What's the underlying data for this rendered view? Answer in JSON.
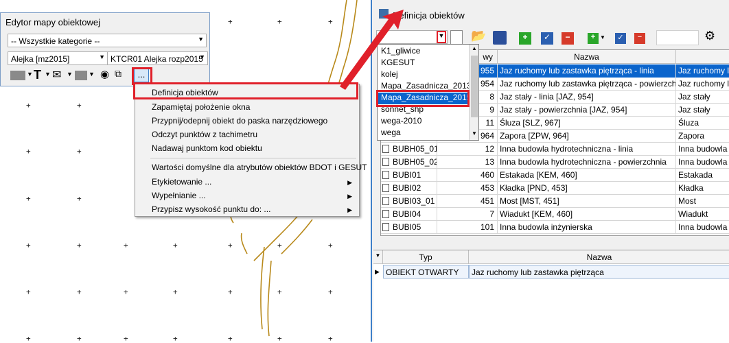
{
  "editor": {
    "title": "Edytor mapy obiektowej",
    "category_combo": "-- Wszystkie kategorie --",
    "layer_combo": "Alejka [mz2015]",
    "object_combo": "KTCR01 Alejka rozp2015",
    "more_button": "..."
  },
  "context_menu": {
    "items": [
      {
        "label": "Definicja obiektów"
      },
      {
        "label": "Zapamiętaj położenie okna"
      },
      {
        "label": "Przypnij/odepnij obiekt do paska narzędziowego"
      },
      {
        "label": "Odczyt punktów z tachimetru"
      },
      {
        "label": "Nadawaj punktom kod obiektu"
      },
      {
        "label": "Wartości domyślne dla atrybutów obiektów BDOT i GESUT"
      },
      {
        "label": "Etykietowanie ..."
      },
      {
        "label": "Wypełnianie ..."
      },
      {
        "label": "Przypisz wysokość punktu do: ..."
      }
    ]
  },
  "definitions_window": {
    "title": "Definicja obiektów",
    "columns": [
      "wy",
      "Nazwa",
      ""
    ],
    "rows": [
      {
        "code": "",
        "num": "955",
        "name": "Jaz ruchomy lub zastawka piętrząca - linia",
        "type": "Jaz ruchomy lub"
      },
      {
        "code": "",
        "num": "954",
        "name": "Jaz ruchomy lub zastawka piętrząca - powierzchnia [...",
        "type": "Jaz ruchomy lub"
      },
      {
        "code": "",
        "num": "8",
        "name": "Jaz stały - linia [JAZ, 954]",
        "type": "Jaz stały"
      },
      {
        "code": "",
        "num": "9",
        "name": "Jaz stały - powierzchnia [JAZ, 954]",
        "type": "Jaz stały"
      },
      {
        "code": "",
        "num": "11",
        "name": "Śluza [SLZ, 967]",
        "type": "Śluza"
      },
      {
        "code": "",
        "num": "964",
        "name": "Zapora [ZPW, 964]",
        "type": "Zapora"
      },
      {
        "code": "BUBH05_01",
        "num": "12",
        "name": "Inna budowla hydrotechniczna - linia",
        "type": "Inna budowla hy"
      },
      {
        "code": "BUBH05_02",
        "num": "13",
        "name": "Inna budowla hydrotechniczna - powierzchnia",
        "type": "Inna budowla hy"
      },
      {
        "code": "BUBI01",
        "num": "460",
        "name": "Estakada [KEM, 460]",
        "type": "Estakada"
      },
      {
        "code": "BUBI02",
        "num": "453",
        "name": "Kładka  [PND, 453]",
        "type": "Kładka"
      },
      {
        "code": "BUBI03_01",
        "num": "451",
        "name": "Most [MST, 451]",
        "type": "Most"
      },
      {
        "code": "BUBI04",
        "num": "7",
        "name": "Wiadukt [KEM, 460]",
        "type": "Wiadukt"
      },
      {
        "code": "BUBI05",
        "num": "101",
        "name": "Inna budowla inżynierska",
        "type": "Inna budowla in"
      }
    ],
    "dropdown_items": [
      "K1_gliwice",
      "KGESUT",
      "kolej",
      "Mapa_Zasadnicza_2013",
      "Mapa_Zasadnicza_2015",
      "sonnet_shp",
      "wega-2010",
      "wega"
    ],
    "lower_table": {
      "columns": [
        "Typ",
        "Nazwa"
      ],
      "row": {
        "type": "OBIEKT OTWARTY",
        "name": "Jaz ruchomy lub zastawka piętrząca"
      }
    }
  },
  "colors": {
    "highlight_red": "#e0202a",
    "selection_blue": "#0a64cc",
    "map_feature": "#b8891a"
  }
}
